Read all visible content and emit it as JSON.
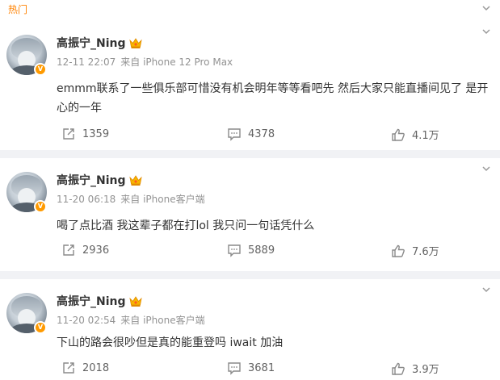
{
  "header": {
    "title": "热门"
  },
  "posts": [
    {
      "username": "高振宁_Ning",
      "time": "12-11 22:07",
      "source": "来自 iPhone 12 Pro Max",
      "content": "emmm联系了一些俱乐部可惜没有机会明年等等看吧先 然后大家只能直播间见了 是开心的一年",
      "reposts": "1359",
      "comments": "4378",
      "likes": "4.1万"
    },
    {
      "username": "高振宁_Ning",
      "time": "11-20 06:18",
      "source": "来自 iPhone客户端",
      "content": "喝了点比酒 我这辈子都在打lol  我只问一句话凭什么",
      "reposts": "2936",
      "comments": "5889",
      "likes": "7.6万"
    },
    {
      "username": "高振宁_Ning",
      "time": "11-20 02:54",
      "source": "来自 iPhone客户端",
      "content": "下山的路会很吵但是真的能重登吗 iwait  加油",
      "reposts": "2018",
      "comments": "3681",
      "likes": "3.9万"
    }
  ],
  "colors": {
    "accent": "#ff8200",
    "meta": "#939393",
    "divider": "#f1f2f5",
    "text": "#333333"
  },
  "icons": [
    "chevron-down-icon",
    "verified-badge-icon",
    "crown-icon",
    "repost-icon",
    "comment-icon",
    "like-icon"
  ]
}
